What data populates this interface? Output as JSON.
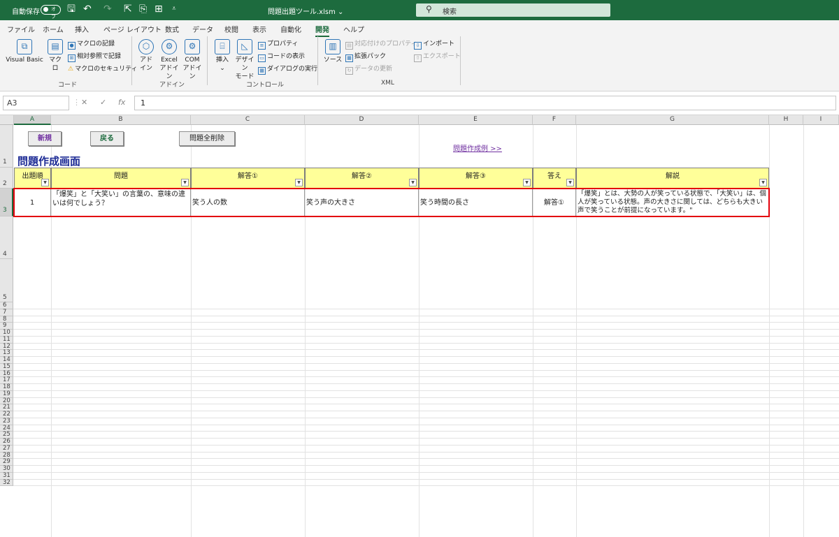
{
  "titlebar": {
    "autosave_label": "自動保存",
    "autosave_state": "オフ",
    "document_title": "問題出題ツール.xlsm ⌄",
    "search_placeholder": "検索"
  },
  "ribbon_tabs": [
    "ファイル",
    "ホーム",
    "挿入",
    "ページ レイアウト",
    "数式",
    "データ",
    "校閲",
    "表示",
    "自動化",
    "開発",
    "ヘルプ"
  ],
  "ribbon": {
    "code": {
      "visual_basic": "Visual Basic",
      "macro": "マクロ",
      "record_macro": "マクロの記録",
      "relative_ref": "相対参照で記録",
      "macro_security": "マクロのセキュリティ",
      "group": "コード"
    },
    "addins": {
      "addin_1": "アド",
      "addin_2": "イン",
      "excel_1": "Excel",
      "excel_2": "アドイン",
      "com_1": "COM",
      "com_2": "アドイン",
      "group": "アドイン"
    },
    "controls": {
      "insert": "挿入",
      "insert_arrow": "⌄",
      "design_1": "デザイン",
      "design_2": "モード",
      "properties": "プロパティ",
      "view_code": "コードの表示",
      "run_dialog": "ダイアログの実行",
      "group": "コントロール"
    },
    "xml": {
      "source": "ソース",
      "map_props": "対応付けのプロパティ",
      "expansion": "拡張パック",
      "refresh": "データの更新",
      "import": "インポート",
      "export": "エクスポート",
      "group": "XML"
    }
  },
  "formula_bar": {
    "name_box": "A3",
    "cancel": "✕",
    "enter": "✓",
    "fx": "fx",
    "value": "1"
  },
  "columns": [
    "A",
    "B",
    "C",
    "D",
    "E",
    "F",
    "G",
    "H",
    "I"
  ],
  "rows": [
    "1",
    "2",
    "3",
    "4",
    "5",
    "6",
    "7",
    "8",
    "9",
    "10",
    "11",
    "12",
    "13",
    "14",
    "15",
    "16",
    "17",
    "18",
    "19",
    "20",
    "21",
    "22",
    "23",
    "24",
    "25",
    "26",
    "27",
    "28",
    "29",
    "30",
    "31",
    "32"
  ],
  "sheet": {
    "btn_new": "新規",
    "btn_back": "戻る",
    "btn_delete_all": "問題全削除",
    "title": "問題作成画面",
    "link": "問題作成例 >>",
    "headers": [
      "出題順",
      "問題",
      "解答①",
      "解答②",
      "解答③",
      "答え",
      "解説"
    ],
    "row": {
      "order": "1",
      "question": "「爆笑」と「大笑い」の言葉の、意味の違いは何でしょう？",
      "ans1": "笑う人の数",
      "ans2": "笑う声の大きさ",
      "ans3": "笑う時間の長さ",
      "answer": "解答①",
      "explanation": "「爆笑」とは、大勢の人が笑っている状態で、「大笑い」は、個人が笑っている状態。声の大きさに関しては、どちらも大きい声で笑うことが前提になっています。\""
    }
  },
  "colors": {
    "title_bar": "#1d6b3e",
    "header_fill": "#ffff99",
    "selection_border": "#e3000b",
    "sheet_title": "#1f2d96"
  }
}
